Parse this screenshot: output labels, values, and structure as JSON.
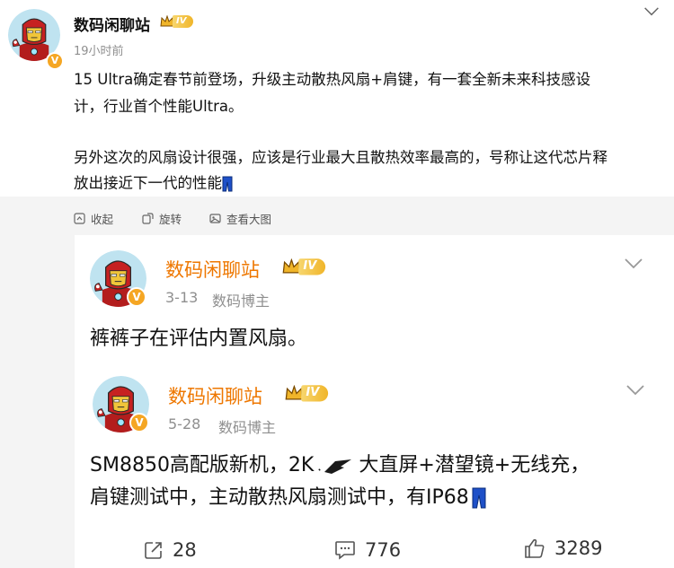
{
  "post": {
    "author": "数码闲聊站",
    "level_badge": "IV",
    "verified_badge": "V",
    "time": "19小时前",
    "text_lines": [
      "15 Ultra确定春节前登场，升级主动散热风扇+肩键，有一套全新未来科技感设",
      "计，行业首个性能Ultra。",
      "另外这次的风扇设计很强，应该是行业最大且散热效率最高的，号称让这代芯片释",
      "放出接近下一代的性能"
    ],
    "actions": {
      "collapse": "收起",
      "rotate": "旋转",
      "view_large": "查看大图"
    }
  },
  "cards": [
    {
      "author": "数码闲聊站",
      "level_badge": "IV",
      "date": "3-13",
      "role": "数码博主",
      "text": "裤裤子在评估内置风扇。"
    },
    {
      "author": "数码闲聊站",
      "level_badge": "IV",
      "date": "5-28",
      "role": "数码博主",
      "text_line1_a": "SM8850高配版新机，2K",
      "text_line1_b": "大直屏+潜望镜+无线充，",
      "text_line2": "肩键测试中，主动散热风扇测试中，有IP68"
    }
  ],
  "footer": {
    "reposts": "28",
    "comments": "776",
    "likes": "3289"
  },
  "colors": {
    "username_orange": "#ee7700",
    "meta_gray": "#8f8f8f",
    "badge_gold": "#f0b52a",
    "verified_orange": "#f5a623"
  },
  "icons": {
    "avatar": "iron-man-avatar",
    "collapse": "collapse-icon",
    "rotate": "rotate-icon",
    "view_large": "image-view-icon",
    "repost": "repost-icon",
    "comment": "comment-icon",
    "like": "like-icon",
    "more": "chevron-down-icon"
  }
}
